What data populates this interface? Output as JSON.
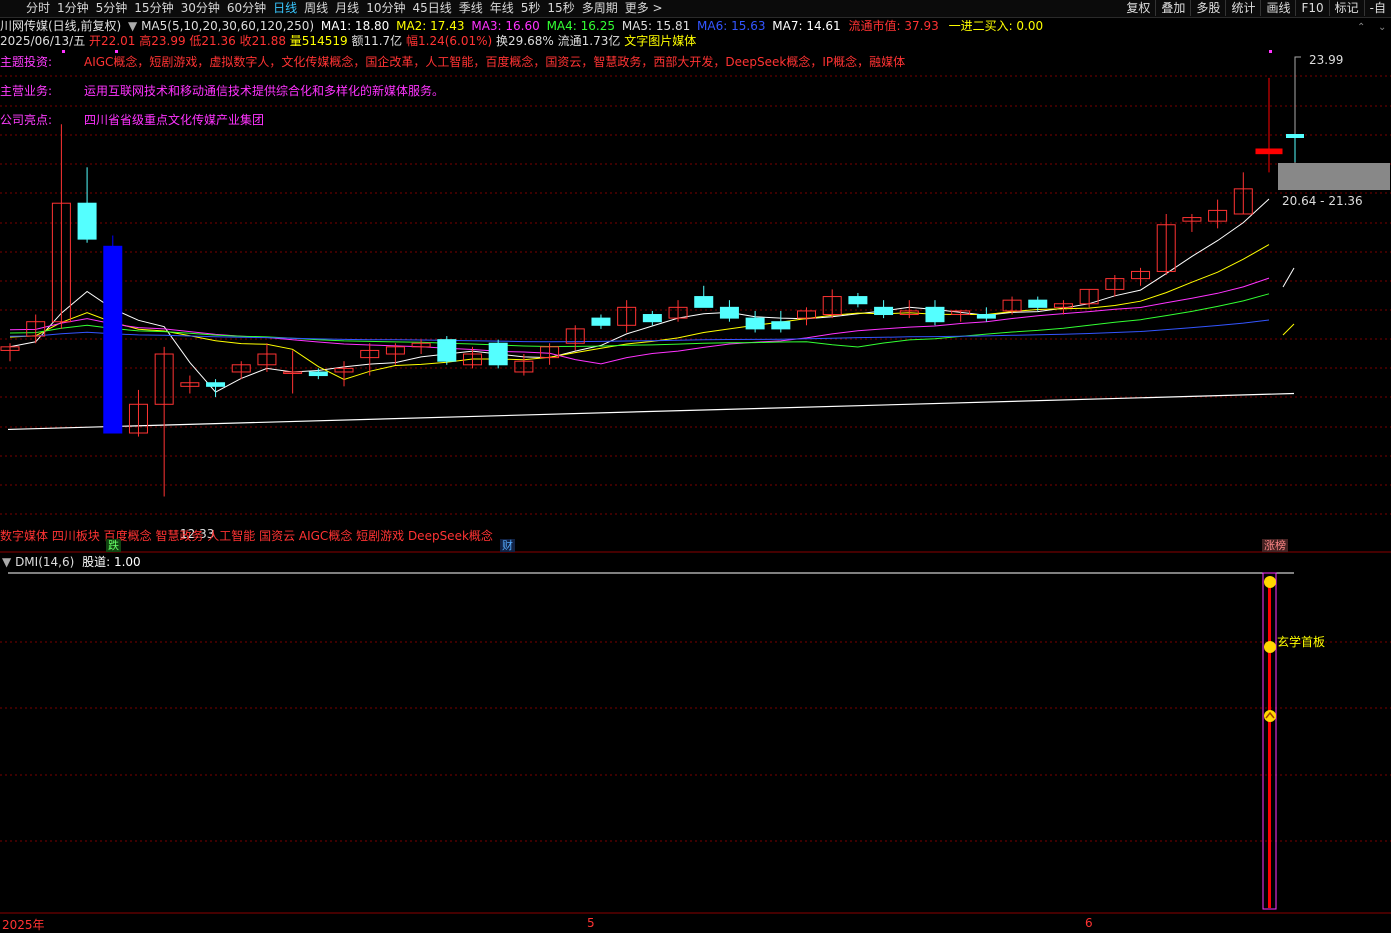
{
  "topbar": {
    "stock_name": "川网传媒(日线,前复权)",
    "periods": [
      "分时",
      "1分钟",
      "5分钟",
      "15分钟",
      "30分钟",
      "60分钟",
      "日线",
      "周线",
      "月线",
      "10分钟",
      "45日线",
      "季线",
      "年线",
      "5秒",
      "15秒",
      "多周期",
      "更多 >"
    ],
    "active_period": "日线",
    "tools": [
      "复权",
      "叠加",
      "多股",
      "统计",
      "画线",
      "F10",
      "标记",
      "-自"
    ]
  },
  "ma_line": {
    "params": "MA5(5,10,20,30,60,120,250)",
    "items": [
      {
        "label": "MA1: 18.80",
        "color": "#ffffff"
      },
      {
        "label": "MA2: 17.43",
        "color": "#ffff00"
      },
      {
        "label": "MA3: 16.60",
        "color": "#ff33ff"
      },
      {
        "label": "MA4: 16.25",
        "color": "#33ff33"
      },
      {
        "label": "MA5: 15.81",
        "color": "#dddddd"
      },
      {
        "label": "MA6: 15.63",
        "color": "#3355ff"
      },
      {
        "label": "MA7: 14.61",
        "color": "#ffffff"
      }
    ],
    "float_cap": "流通市值: 37.93",
    "jump": "一进二买入: 0.00"
  },
  "quote_line": {
    "date": "2025/06/13/五",
    "open": "开22.01",
    "high": "高23.99",
    "low": "低21.36",
    "close": "收21.88",
    "volume": "量514519",
    "amount": "额11.7亿",
    "change": "幅1.24(6.01%)",
    "turnover": "换29.68%",
    "float_shares": "流通1.73亿",
    "industry": "文字图片媒体"
  },
  "info": [
    {
      "key": "主题投资:",
      "value": "AIGC概念，短剧游戏，虚拟数字人，文化传媒概念，国企改革，人工智能，百度概念，国资云，智慧政务，西部大开发，DeepSeek概念，IP概念，融媒体",
      "color": "#ff3333"
    },
    {
      "key": "主营业务:",
      "value": "运用互联网技术和移动通信技术提供综合化和多样化的新媒体服务。",
      "color": "#ff33ff"
    },
    {
      "key": "公司亮点:",
      "value": "四川省省级重点文化传媒产业集团",
      "color": "#ff33ff"
    }
  ],
  "price_labels": {
    "high_label": "23.99",
    "range_label": "20.64 - 21.36",
    "low_label": "12.33"
  },
  "concepts": "数字媒体 四川板块 百度概念 智慧政务 人工智能 国资云 AIGC概念 短剧游戏 DeepSeek概念",
  "markers": {
    "die": "跌",
    "cai": "财",
    "zhangbang": "涨榜"
  },
  "indicator": {
    "title": "DMI(14,6)",
    "value": "股道: 1.00",
    "annotation": "玄学首板"
  },
  "xaxis": {
    "year": "2025年",
    "may": "5",
    "june": "6"
  },
  "colors": {
    "up": "#ff3333",
    "down": "#54ffff",
    "big_down": "#0000ff",
    "big_up": "#ff0000",
    "grid": "#7a0000"
  },
  "chart_data": {
    "type": "candlestick",
    "candles": [
      [
        16.4,
        16.6,
        16.1,
        16.5
      ],
      [
        16.8,
        17.4,
        16.6,
        17.2
      ],
      [
        17.2,
        22.7,
        17.0,
        20.5
      ],
      [
        20.5,
        21.5,
        19.4,
        19.5
      ],
      [
        19.3,
        19.6,
        14.1,
        14.1
      ],
      [
        14.1,
        15.3,
        14.0,
        14.9
      ],
      [
        14.9,
        16.5,
        12.33,
        16.3
      ],
      [
        15.4,
        15.7,
        15.2,
        15.5
      ],
      [
        15.5,
        15.6,
        15.1,
        15.4
      ],
      [
        15.8,
        16.1,
        15.6,
        16.0
      ],
      [
        16.0,
        16.6,
        15.8,
        16.3
      ],
      [
        15.8,
        16.4,
        15.2,
        15.8
      ],
      [
        15.8,
        15.9,
        15.6,
        15.7
      ],
      [
        15.8,
        16.1,
        15.4,
        15.9
      ],
      [
        16.2,
        16.6,
        15.7,
        16.4
      ],
      [
        16.3,
        16.6,
        16.0,
        16.5
      ],
      [
        16.5,
        16.7,
        16.3,
        16.6
      ],
      [
        16.7,
        16.8,
        16.0,
        16.1
      ],
      [
        16.0,
        16.5,
        15.9,
        16.3
      ],
      [
        16.6,
        16.7,
        15.9,
        16.0
      ],
      [
        15.8,
        16.3,
        15.7,
        16.1
      ],
      [
        16.2,
        16.6,
        16.0,
        16.5
      ],
      [
        16.6,
        17.1,
        16.4,
        17.0
      ],
      [
        17.3,
        17.4,
        17.0,
        17.1
      ],
      [
        17.1,
        17.8,
        16.9,
        17.6
      ],
      [
        17.4,
        17.5,
        17.1,
        17.2
      ],
      [
        17.3,
        17.8,
        17.2,
        17.6
      ],
      [
        17.9,
        18.2,
        17.6,
        17.6
      ],
      [
        17.6,
        17.8,
        17.2,
        17.3
      ],
      [
        17.3,
        17.5,
        16.9,
        17.0
      ],
      [
        17.2,
        17.5,
        16.9,
        17.0
      ],
      [
        17.3,
        17.6,
        17.1,
        17.5
      ],
      [
        17.4,
        18.1,
        17.3,
        17.9
      ],
      [
        17.9,
        18.0,
        17.6,
        17.7
      ],
      [
        17.6,
        17.8,
        17.3,
        17.4
      ],
      [
        17.4,
        17.8,
        17.3,
        17.5
      ],
      [
        17.6,
        17.8,
        17.1,
        17.2
      ],
      [
        17.4,
        17.5,
        17.2,
        17.5
      ],
      [
        17.4,
        17.6,
        17.2,
        17.3
      ],
      [
        17.5,
        17.9,
        17.4,
        17.8
      ],
      [
        17.8,
        17.9,
        17.5,
        17.6
      ],
      [
        17.6,
        17.8,
        17.4,
        17.7
      ],
      [
        17.7,
        18.1,
        17.6,
        18.1
      ],
      [
        18.1,
        18.5,
        17.9,
        18.4
      ],
      [
        18.4,
        18.7,
        18.2,
        18.6
      ],
      [
        18.6,
        20.2,
        18.5,
        19.9
      ],
      [
        20.0,
        20.2,
        19.7,
        20.1
      ],
      [
        20.0,
        20.6,
        19.8,
        20.3
      ],
      [
        20.2,
        21.36,
        20.2,
        20.9
      ],
      [
        22.01,
        23.99,
        21.36,
        21.88
      ]
    ],
    "ylim": [
      11.9,
      24.6
    ]
  }
}
